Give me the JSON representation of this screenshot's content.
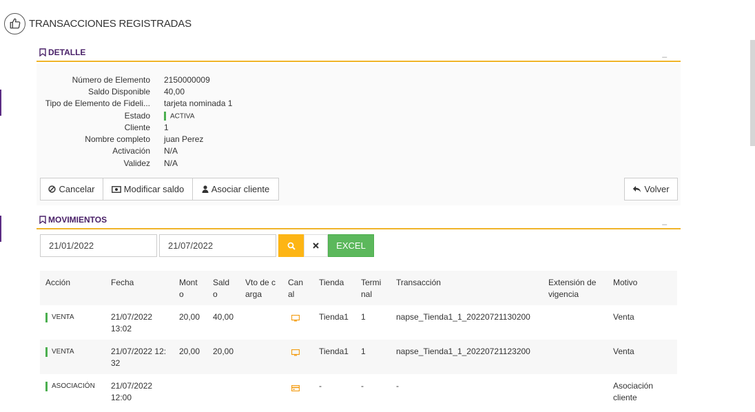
{
  "page": {
    "title": "TRANSACCIONES REGISTRADAS",
    "icon": "thumbs-up-icon"
  },
  "detail": {
    "section_title": "DETALLE",
    "collapse_label": "_",
    "fields": [
      {
        "label": "Número de Elemento",
        "value": "2150000009"
      },
      {
        "label": "Saldo Disponible",
        "value": "40,00"
      },
      {
        "label": "Tipo de Elemento de Fideli...",
        "value": "tarjeta nominada 1"
      },
      {
        "label": "Estado",
        "value": "ACTIVA"
      },
      {
        "label": "Cliente",
        "value": "1"
      },
      {
        "label": "Nombre completo",
        "value": "juan Perez"
      },
      {
        "label": "Activación",
        "value": "N/A"
      },
      {
        "label": "Validez",
        "value": "N/A"
      }
    ],
    "buttons": {
      "cancel": "Cancelar",
      "modify": "Modificar saldo",
      "associate": "Asociar cliente",
      "back": "Volver"
    },
    "status_color": "#4caf50"
  },
  "movements": {
    "section_title": "MOVIMIENTOS",
    "collapse_label": "_",
    "date_from": "21/01/2022",
    "date_to": "21/07/2022",
    "excel_label": "EXCEL",
    "columns": [
      {
        "l1": "Acción",
        "l2": ""
      },
      {
        "l1": "Fecha",
        "l2": ""
      },
      {
        "l1": "Mont",
        "l2": "o"
      },
      {
        "l1": "Sald",
        "l2": "o"
      },
      {
        "l1": "Vto de c",
        "l2": "arga"
      },
      {
        "l1": "Can",
        "l2": "al"
      },
      {
        "l1": "Tienda",
        "l2": ""
      },
      {
        "l1": "Termi",
        "l2": "nal"
      },
      {
        "l1": "Transacción",
        "l2": ""
      },
      {
        "l1": "Extensión de",
        "l2": "vigencia"
      },
      {
        "l1": "Motivo",
        "l2": ""
      }
    ],
    "rows": [
      {
        "accion": "VENTA",
        "fecha1": "21/07/2022",
        "fecha2": "13:02",
        "monto": "20,00",
        "saldo": "40,00",
        "vto": "",
        "canal_icon": "monitor-icon",
        "tienda": "Tienda1",
        "terminal": "1",
        "transaccion": "napse_Tienda1_1_20220721130200",
        "extension": "",
        "motivo1": "Venta",
        "motivo2": ""
      },
      {
        "accion": "VENTA",
        "fecha1": "21/07/2022 12:",
        "fecha2": "32",
        "monto": "20,00",
        "saldo": "20,00",
        "vto": "",
        "canal_icon": "monitor-icon",
        "tienda": "Tienda1",
        "terminal": "1",
        "transaccion": "napse_Tienda1_1_20220721123200",
        "extension": "",
        "motivo1": "Venta",
        "motivo2": ""
      },
      {
        "accion": "ASOCIACIÓN",
        "fecha1": "21/07/2022",
        "fecha2": "12:00",
        "monto": "",
        "saldo": "",
        "vto": "",
        "canal_icon": "card-icon",
        "tienda": "-",
        "terminal": "-",
        "transaccion": "-",
        "extension": "",
        "motivo1": "Asociación",
        "motivo2": "cliente"
      }
    ]
  },
  "colors": {
    "accent": "#f0b429",
    "section_title": "#4a2168",
    "search": "#fdb515",
    "excel": "#5cb85c",
    "channel_icon": "#f39c12"
  }
}
